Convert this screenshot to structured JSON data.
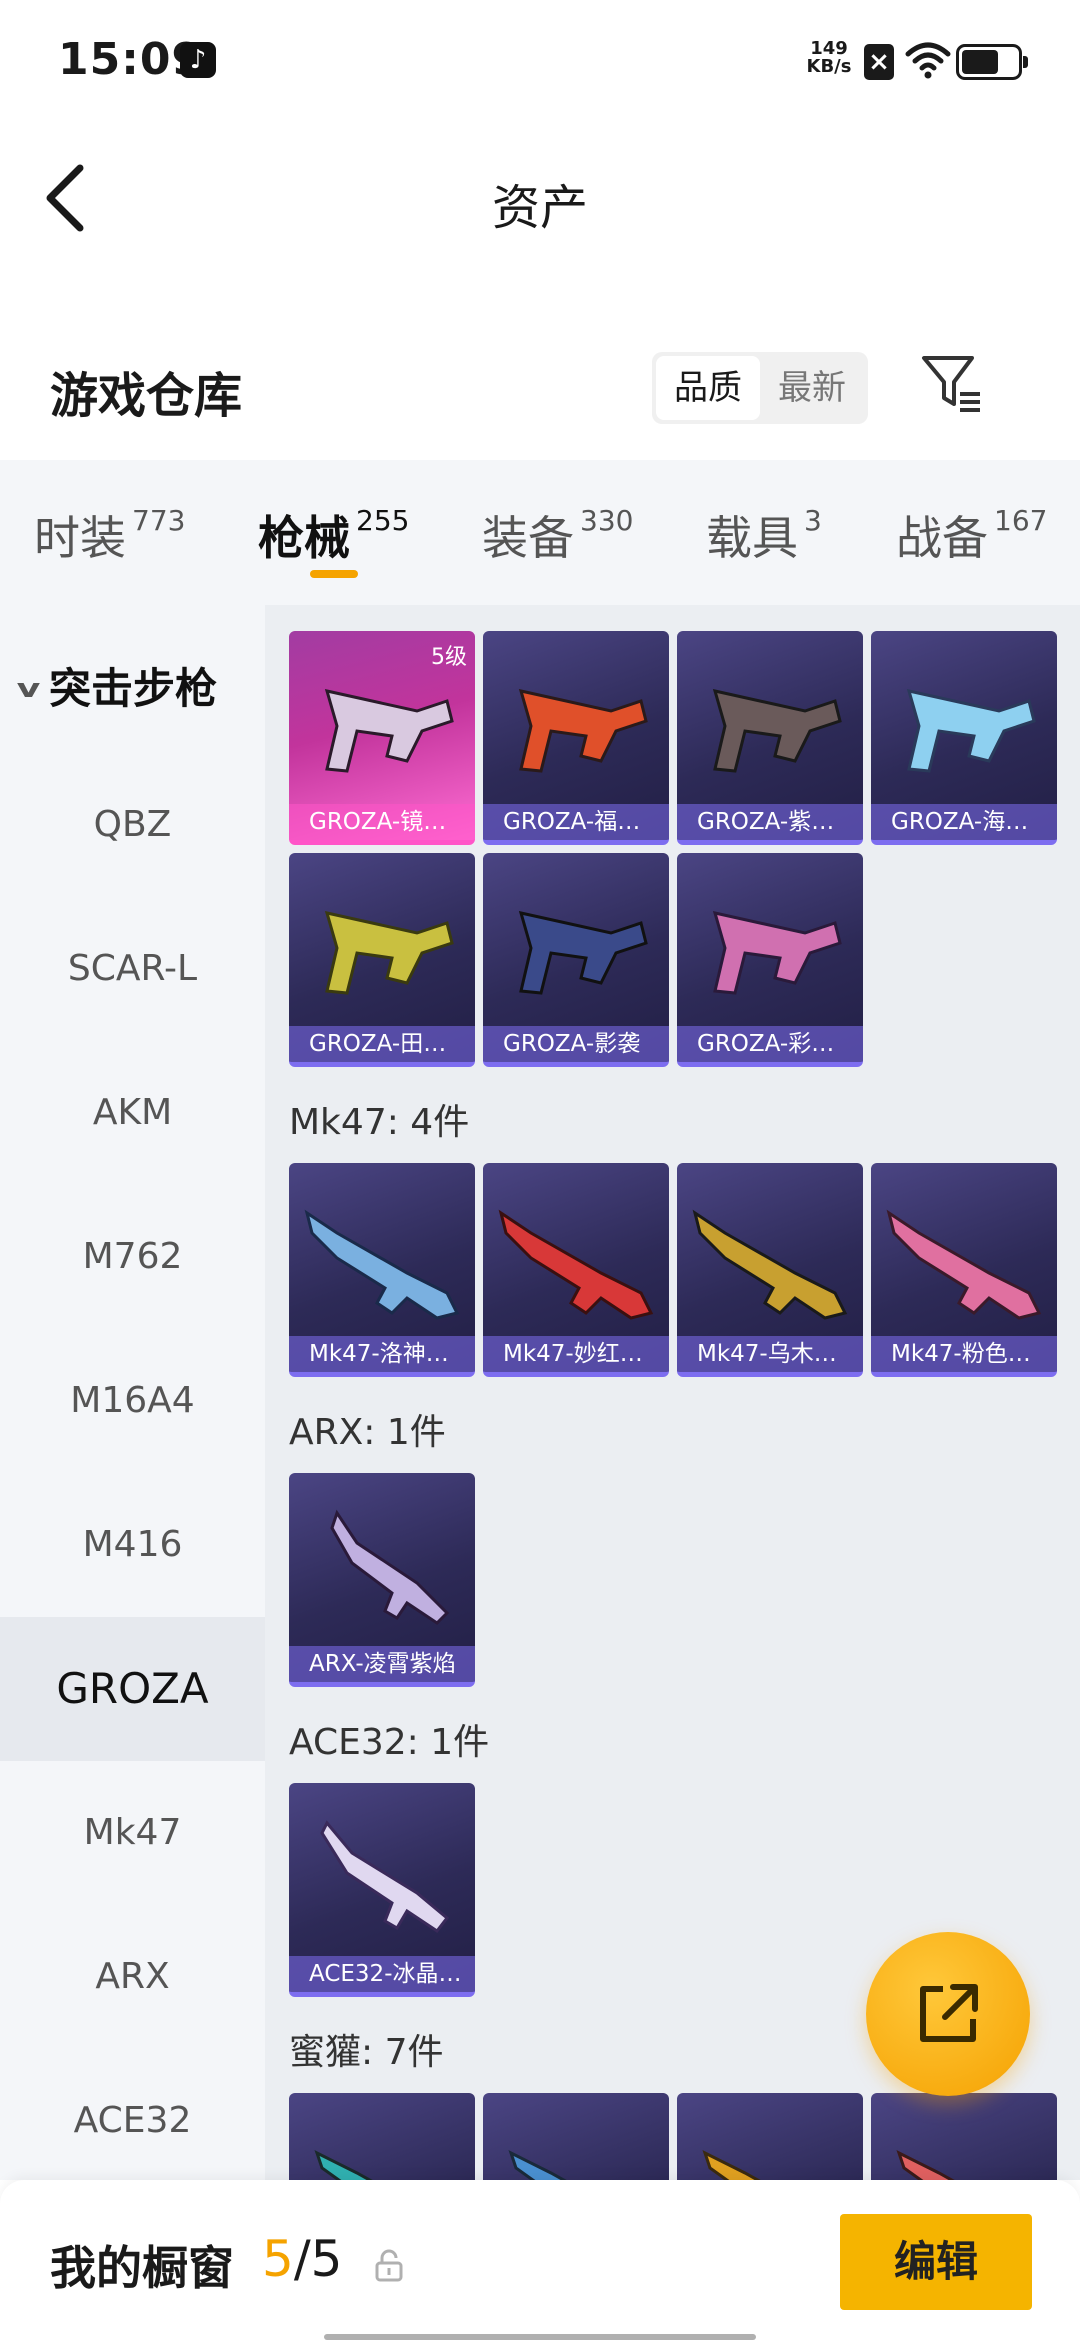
{
  "status_bar": {
    "time": "15:09",
    "net_speed_value": "149",
    "net_speed_unit": "KB/s"
  },
  "header": {
    "title": "资产"
  },
  "warehouse": {
    "title": "游戏仓库",
    "sort_options": [
      "品质",
      "最新"
    ],
    "selected_sort": "品质"
  },
  "tabs": [
    {
      "label": "时装",
      "count": "773"
    },
    {
      "label": "枪械",
      "count": "255"
    },
    {
      "label": "装备",
      "count": "330"
    },
    {
      "label": "载具",
      "count": "3"
    },
    {
      "label": "战备",
      "count": "167"
    }
  ],
  "active_tab": "枪械",
  "sidenav": {
    "group": "突击步枪",
    "items": [
      "QBZ",
      "SCAR-L",
      "AKM",
      "M762",
      "M16A4",
      "M416",
      "GROZA",
      "Mk47",
      "ARX",
      "ACE32"
    ],
    "active": "GROZA"
  },
  "sections": [
    {
      "heading": "",
      "items": [
        {
          "label": "GROZA-镜…",
          "level": "5级",
          "highlight": true
        },
        {
          "label": "GROZA-福…"
        },
        {
          "label": "GROZA-紫…"
        },
        {
          "label": "GROZA-海…"
        },
        {
          "label": "GROZA-田…"
        },
        {
          "label": "GROZA-影袭"
        },
        {
          "label": "GROZA-彩…"
        }
      ]
    },
    {
      "heading": "Mk47: 4件",
      "items": [
        {
          "label": "Mk47-洛神…"
        },
        {
          "label": "Mk47-妙红…"
        },
        {
          "label": "Mk47-乌木…"
        },
        {
          "label": "Mk47-粉色…"
        }
      ]
    },
    {
      "heading": "ARX: 1件",
      "items": [
        {
          "label": "ARX-凌霄紫焰"
        }
      ]
    },
    {
      "heading": "ACE32: 1件",
      "items": [
        {
          "label": "ACE32-冰晶…"
        }
      ]
    },
    {
      "heading": "蜜獾: 7件",
      "items": [
        {
          "label": ""
        },
        {
          "label": ""
        },
        {
          "label": ""
        },
        {
          "label": ""
        }
      ]
    }
  ],
  "bottom_bar": {
    "title": "我的橱窗",
    "count_used": "5",
    "count_total": "/5",
    "edit_label": "编辑"
  },
  "colors": {
    "accent": "#f5a300",
    "card_bg": "#2d2a57",
    "card_highlight": "#c2349c",
    "edit_button": "#f5b400"
  },
  "icons": [
    "tiktok-icon",
    "sim-icon",
    "wifi-icon",
    "battery-icon",
    "back-icon",
    "filter-icon",
    "share-icon",
    "lock-icon"
  ]
}
